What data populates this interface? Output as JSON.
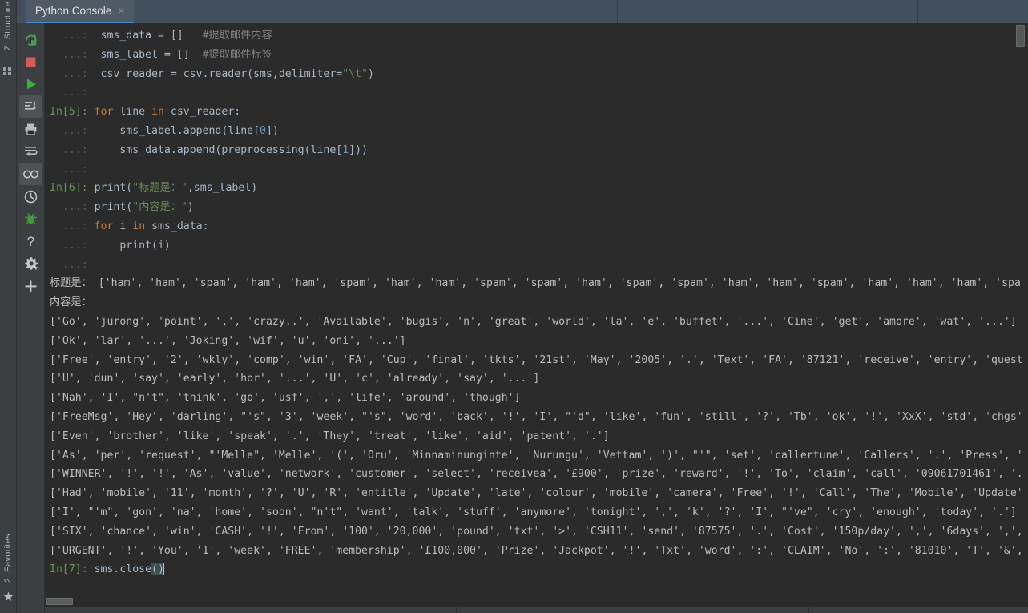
{
  "window": {
    "left_tool_tabs": [
      {
        "label": "Z: Structure",
        "icon": "structure-icon"
      },
      {
        "label": "2: Favorites",
        "icon": "star-icon"
      }
    ]
  },
  "tabbar": {
    "tabs": [
      {
        "label": "Python Console",
        "close": "×"
      }
    ]
  },
  "toolbar": {
    "buttons": [
      {
        "name": "rerun-icon",
        "title": "Rerun"
      },
      {
        "name": "stop-icon",
        "title": "Stop"
      },
      {
        "name": "execute-icon",
        "title": "Execute Current Statement"
      },
      {
        "name": "scroll-to-end-icon",
        "title": "Scroll to the end"
      },
      {
        "name": "print-icon",
        "title": "Print"
      },
      {
        "name": "soft-wrap-icon",
        "title": "Use Soft Wraps"
      },
      {
        "name": "show-variables-icon",
        "title": "Show Variables"
      },
      {
        "name": "history-icon",
        "title": "Browse History"
      },
      {
        "name": "debug-icon",
        "title": "Attach Debugger"
      },
      {
        "name": "help-icon",
        "title": "Help"
      },
      {
        "name": "settings-icon",
        "title": "Settings"
      },
      {
        "name": "add-icon",
        "title": "New Console"
      }
    ]
  },
  "colors": {
    "background": "#2b2b2b",
    "chrome": "#3c3f41",
    "tab_active": "#4e5a65",
    "tab_underline": "#4a88c7",
    "prompt_green": "#629755",
    "keyword_orange": "#cc7832",
    "string_green": "#6a8759",
    "number_blue": "#6897bb",
    "text": "#a9b7c6",
    "output": "#bbbbbb",
    "highlight": "#3b514d"
  },
  "console": {
    "lines": [
      {
        "prompt": "  ...:",
        "prompt_cls": "pr-dots",
        "parts": [
          {
            "t": "  sms_data = [] ",
            "c": "plain"
          },
          {
            "t": "  #提取邮件内容",
            "c": "cmt"
          }
        ]
      },
      {
        "prompt": "  ...:",
        "prompt_cls": "pr-dots",
        "parts": [
          {
            "t": "  sms_label = [] ",
            "c": "plain"
          },
          {
            "t": " #提取邮件标签",
            "c": "cmt"
          }
        ]
      },
      {
        "prompt": "  ...:",
        "prompt_cls": "pr-dots",
        "parts": [
          {
            "t": "  csv_reader = csv.reader(sms,delimiter=",
            "c": "plain"
          },
          {
            "t": "\"\\t\"",
            "c": "str"
          },
          {
            "t": ")",
            "c": "plain"
          }
        ]
      },
      {
        "prompt": "  ...:",
        "prompt_cls": "pr-dots",
        "parts": []
      },
      {
        "prompt": "In[5]:",
        "prompt_cls": "pr-in",
        "parts": [
          {
            "t": " ",
            "c": "plain"
          },
          {
            "t": "for",
            "c": "kw"
          },
          {
            "t": " line ",
            "c": "plain"
          },
          {
            "t": "in",
            "c": "kw"
          },
          {
            "t": " csv_reader:",
            "c": "plain"
          }
        ]
      },
      {
        "prompt": "  ...:",
        "prompt_cls": "pr-dots",
        "parts": [
          {
            "t": "     sms_label.append(line[",
            "c": "plain"
          },
          {
            "t": "0",
            "c": "num"
          },
          {
            "t": "])",
            "c": "plain"
          }
        ]
      },
      {
        "prompt": "  ...:",
        "prompt_cls": "pr-dots",
        "parts": [
          {
            "t": "     sms_data.append(preprocessing(line[",
            "c": "plain"
          },
          {
            "t": "1",
            "c": "num"
          },
          {
            "t": "]))",
            "c": "plain"
          }
        ]
      },
      {
        "prompt": "  ...:",
        "prompt_cls": "pr-dots",
        "parts": []
      },
      {
        "prompt": "In[6]:",
        "prompt_cls": "pr-in",
        "parts": [
          {
            "t": " print(",
            "c": "plain"
          },
          {
            "t": "\"标题是：\"",
            "c": "str"
          },
          {
            "t": ",sms_label)",
            "c": "plain"
          }
        ]
      },
      {
        "prompt": "  ...:",
        "prompt_cls": "pr-dots",
        "parts": [
          {
            "t": " print(",
            "c": "plain"
          },
          {
            "t": "\"内容是：\"",
            "c": "str"
          },
          {
            "t": ")",
            "c": "plain"
          }
        ]
      },
      {
        "prompt": "  ...:",
        "prompt_cls": "pr-dots",
        "parts": [
          {
            "t": " ",
            "c": "plain"
          },
          {
            "t": "for",
            "c": "kw"
          },
          {
            "t": " i ",
            "c": "plain"
          },
          {
            "t": "in",
            "c": "kw"
          },
          {
            "t": " sms_data:",
            "c": "plain"
          }
        ]
      },
      {
        "prompt": "  ...:",
        "prompt_cls": "pr-dots",
        "parts": [
          {
            "t": "     print(i)",
            "c": "plain"
          }
        ]
      },
      {
        "prompt": "  ...:",
        "prompt_cls": "pr-dots",
        "parts": []
      },
      {
        "prompt": "",
        "prompt_cls": "out",
        "parts": [
          {
            "t": "标题是： ['ham', 'ham', 'spam', 'ham', 'ham', 'spam', 'ham', 'ham', 'spam', 'spam', 'ham', 'spam', 'spam', 'ham', 'ham', 'spam', 'ham', 'ham', 'ham', 'spa",
            "c": "out"
          }
        ]
      },
      {
        "prompt": "",
        "prompt_cls": "out",
        "parts": [
          {
            "t": "内容是：",
            "c": "out"
          }
        ]
      },
      {
        "prompt": "",
        "prompt_cls": "out",
        "parts": [
          {
            "t": "['Go', 'jurong', 'point', ',', 'crazy..', 'Available', 'bugis', 'n', 'great', 'world', 'la', 'e', 'buffet', '...', 'Cine', 'get', 'amore', 'wat', '...']",
            "c": "out"
          }
        ]
      },
      {
        "prompt": "",
        "prompt_cls": "out",
        "parts": [
          {
            "t": "['Ok', 'lar', '...', 'Joking', 'wif', 'u', 'oni', '...']",
            "c": "out"
          }
        ]
      },
      {
        "prompt": "",
        "prompt_cls": "out",
        "parts": [
          {
            "t": "['Free', 'entry', '2', 'wkly', 'comp', 'win', 'FA', 'Cup', 'final', 'tkts', '21st', 'May', '2005', '.', 'Text', 'FA', '87121', 'receive', 'entry', 'quest",
            "c": "out"
          }
        ]
      },
      {
        "prompt": "",
        "prompt_cls": "out",
        "parts": [
          {
            "t": "['U', 'dun', 'say', 'early', 'hor', '...', 'U', 'c', 'already', 'say', '...']",
            "c": "out"
          }
        ]
      },
      {
        "prompt": "",
        "prompt_cls": "out",
        "parts": [
          {
            "t": "['Nah', 'I', \"n't\", 'think', 'go', 'usf', ',', 'life', 'around', 'though']",
            "c": "out"
          }
        ]
      },
      {
        "prompt": "",
        "prompt_cls": "out",
        "parts": [
          {
            "t": "['FreeMsg', 'Hey', 'darling', \"'s\", '3', 'week', \"'s\", 'word', 'back', '!', 'I', \"'d\", 'like', 'fun', 'still', '?', 'Tb', 'ok', '!', 'XxX', 'std', 'chgs'",
            "c": "out"
          }
        ]
      },
      {
        "prompt": "",
        "prompt_cls": "out",
        "parts": [
          {
            "t": "['Even', 'brother', 'like', 'speak', '.', 'They', 'treat', 'like', 'aid', 'patent', '.']",
            "c": "out"
          }
        ]
      },
      {
        "prompt": "",
        "prompt_cls": "out",
        "parts": [
          {
            "t": "['As', 'per', 'request', \"'Melle\", 'Melle', '(', 'Oru', 'Minnaminunginte', 'Nurungu', 'Vettam', ')', \"'\", 'set', 'callertune', 'Callers', '.', 'Press', '",
            "c": "out"
          }
        ]
      },
      {
        "prompt": "",
        "prompt_cls": "out",
        "parts": [
          {
            "t": "['WINNER', '!', '!', 'As', 'value', 'network', 'customer', 'select', 'receivea', '£900', 'prize', 'reward', '!', 'To', 'claim', 'call', '09061701461', '.",
            "c": "out"
          }
        ]
      },
      {
        "prompt": "",
        "prompt_cls": "out",
        "parts": [
          {
            "t": "['Had', 'mobile', '11', 'month', '?', 'U', 'R', 'entitle', 'Update', 'late', 'colour', 'mobile', 'camera', 'Free', '!', 'Call', 'The', 'Mobile', 'Update'",
            "c": "out"
          }
        ]
      },
      {
        "prompt": "",
        "prompt_cls": "out",
        "parts": [
          {
            "t": "['I', \"'m\", 'gon', 'na', 'home', 'soon', \"n't\", 'want', 'talk', 'stuff', 'anymore', 'tonight', ',', 'k', '?', 'I', \"'ve\", 'cry', 'enough', 'today', '.']",
            "c": "out"
          }
        ]
      },
      {
        "prompt": "",
        "prompt_cls": "out",
        "parts": [
          {
            "t": "['SIX', 'chance', 'win', 'CASH', '!', 'From', '100', '20,000', 'pound', 'txt', '>', 'CSH11', 'send', '87575', '.', 'Cost', '150p/day', ',', '6days', ',',",
            "c": "out"
          }
        ]
      },
      {
        "prompt": "",
        "prompt_cls": "out",
        "parts": [
          {
            "t": "['URGENT', '!', 'You', '1', 'week', 'FREE', 'membership', '£100,000', 'Prize', 'Jackpot', '!', 'Txt', 'word', ':', 'CLAIM', 'No', ':', '81010', 'T', '&',",
            "c": "out"
          }
        ]
      },
      {
        "prompt": "In[7]:",
        "prompt_cls": "pr-in",
        "parts": [
          {
            "t": " sms.close",
            "c": "plain"
          },
          {
            "t": "()",
            "c": "hl"
          },
          {
            "t": "|caret|",
            "c": "caret"
          }
        ]
      }
    ]
  },
  "scrollbars": {
    "horizontal_thumb_label": "horizontal-scrollbar-thumb",
    "vertical_thumb_label": "vertical-scrollbar-thumb"
  }
}
